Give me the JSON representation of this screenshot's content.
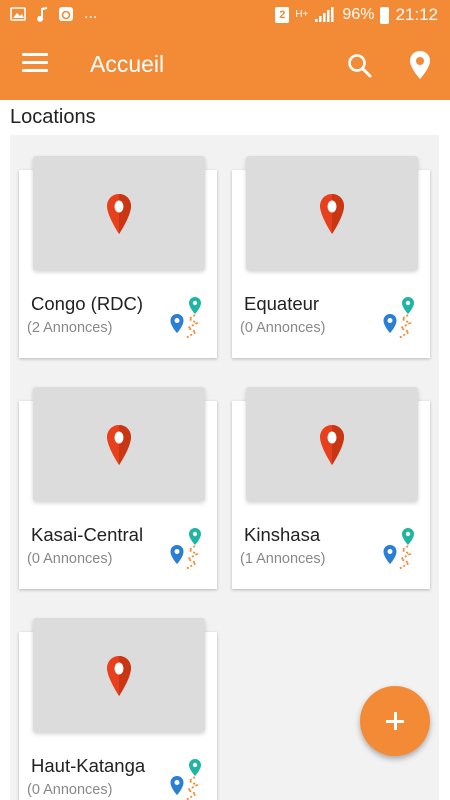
{
  "status_bar": {
    "icons": [
      "image-icon",
      "music-note-icon",
      "browser-icon"
    ],
    "ellipsis": "...",
    "sim_slot": "2",
    "network_type": "H+",
    "battery": "96%",
    "time": "21:12"
  },
  "app_bar": {
    "title": "Accueil",
    "icons": [
      "menu-icon",
      "search-icon",
      "location-icon"
    ]
  },
  "section": {
    "title": "Locations"
  },
  "locations": [
    {
      "name": "Congo (RDC)",
      "count": "(2 Annonces)"
    },
    {
      "name": "Equateur",
      "count": "(0 Annonces)"
    },
    {
      "name": "Kasai-Central",
      "count": "(0 Annonces)"
    },
    {
      "name": "Kinshasa",
      "count": "(1 Annonces)"
    },
    {
      "name": "Haut-Katanga",
      "count": "(0 Annonces)"
    }
  ],
  "fab": {
    "label": "+",
    "icon": "plus-icon"
  },
  "colors": {
    "accent": "#f38b36",
    "pin_red": "#e8401c",
    "route_teal": "#1fb5a3",
    "route_blue": "#2a7fd4"
  }
}
